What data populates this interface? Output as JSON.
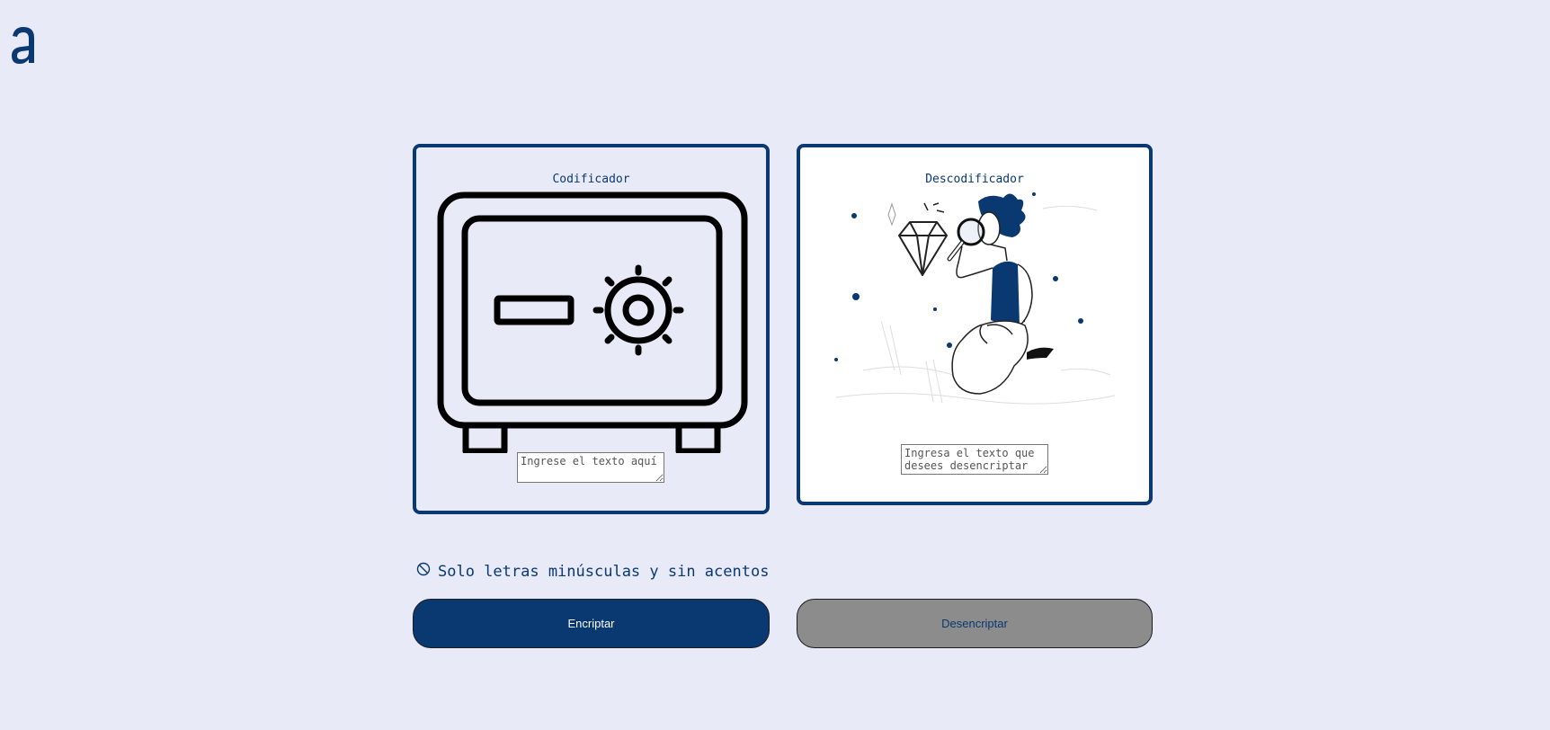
{
  "logo": {
    "icon": "alura-logo-icon"
  },
  "encoder": {
    "title": "Codificador",
    "illustration": "safe-icon",
    "input_placeholder": "Ingrese el texto aquí"
  },
  "decoder": {
    "title": "Descodificador",
    "illustration": "person-magnifier-diamond-illustration",
    "input_placeholder": "Ingresa el texto que desees desencriptar"
  },
  "note": {
    "icon": "prohibited-icon",
    "text": "Solo letras minúsculas y sin acentos"
  },
  "buttons": {
    "encrypt_label": "Encriptar",
    "decrypt_label": "Desencriptar"
  },
  "colors": {
    "background": "#e8ebf7",
    "primary": "#0a3871",
    "secondary_button": "#8c8c8c"
  }
}
